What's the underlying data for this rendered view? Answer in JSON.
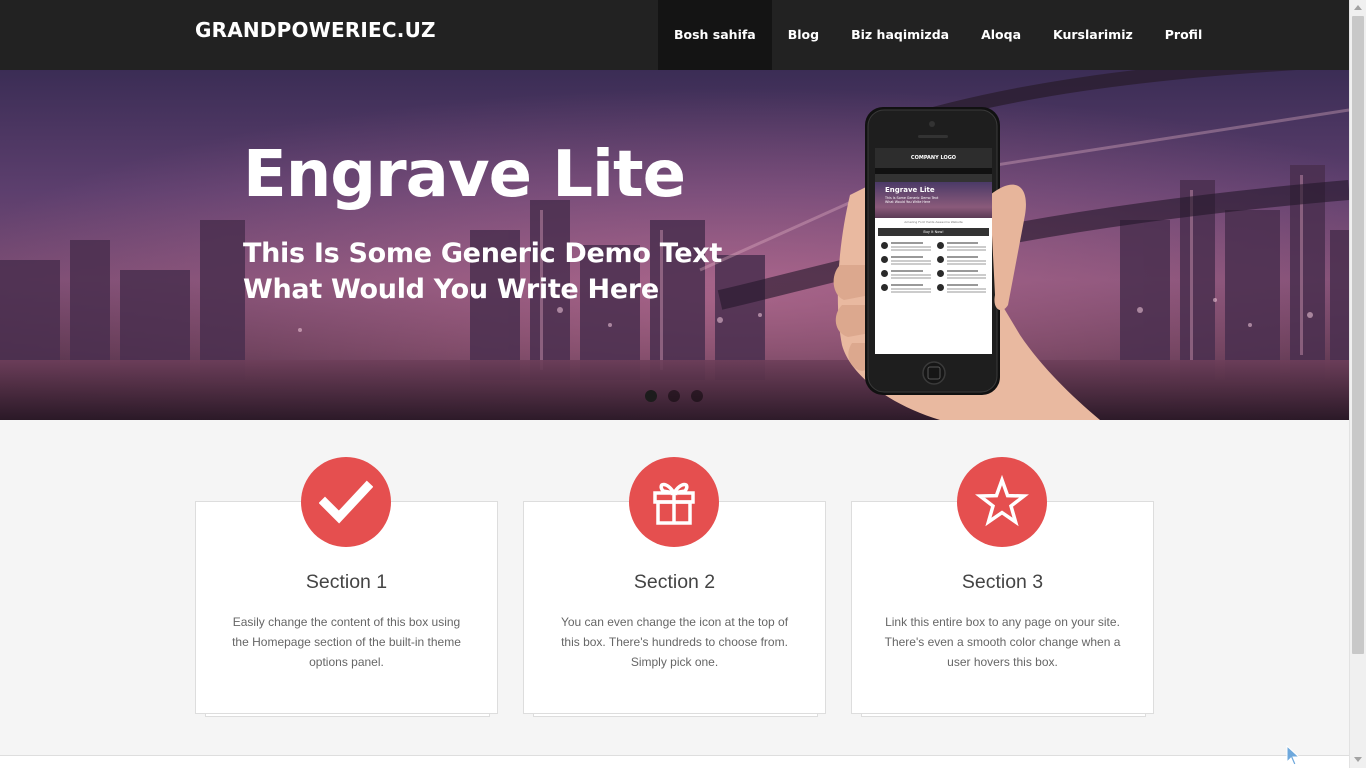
{
  "header": {
    "brand": "GRANDPOWERIEC.UZ",
    "nav": [
      {
        "label": "Bosh sahifa",
        "active": true
      },
      {
        "label": "Blog"
      },
      {
        "label": "Biz haqimizda"
      },
      {
        "label": "Aloqa"
      },
      {
        "label": "Kurslarimiz"
      },
      {
        "label": "Profil"
      }
    ]
  },
  "hero": {
    "title": "Engrave Lite",
    "subtitle_line1": "This Is Some Generic Demo Text",
    "subtitle_line2": "What Would You Write Here",
    "slider_dots": 3,
    "active_dot": 1,
    "phone_screen": {
      "logo": "COMPANY LOGO",
      "banner_title": "Engrave Lite",
      "banner_text": "This Is Some Generic Demo Text What Would You Write Here",
      "tagline": "Amazing Font Yields Awesome Website",
      "button": "Buy It Now!"
    }
  },
  "sections": [
    {
      "icon": "checkmark-icon",
      "title": "Section 1",
      "text": "Easily change the content of this box using the Homepage section of the built-in theme options panel."
    },
    {
      "icon": "gift-icon",
      "title": "Section 2",
      "text": "You can even change the icon at the top of this box. There's hundreds to choose from. Simply pick one."
    },
    {
      "icon": "star-icon",
      "title": "Section 3",
      "text": "Link this entire box to any page on your site. There's even a smooth color change when a user hovers this box."
    }
  ],
  "colors": {
    "topbar": "#222222",
    "nav_active": "#141414",
    "accent_red": "#e54f4f",
    "page_bg": "#f5f5f5"
  }
}
